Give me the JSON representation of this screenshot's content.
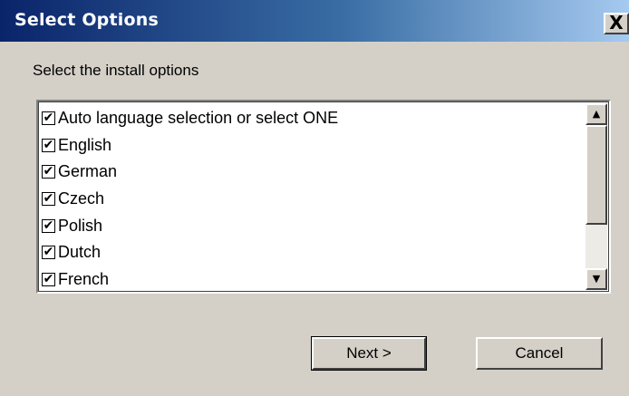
{
  "window": {
    "title": "Select Options",
    "close_glyph": "X"
  },
  "prompt": "Select the install options",
  "options": [
    {
      "label": "Auto language selection or select ONE",
      "checked": true
    },
    {
      "label": "English",
      "checked": true
    },
    {
      "label": "German",
      "checked": true
    },
    {
      "label": "Czech",
      "checked": true
    },
    {
      "label": "Polish",
      "checked": true
    },
    {
      "label": "Dutch",
      "checked": true
    },
    {
      "label": "French",
      "checked": true
    }
  ],
  "check_glyph": "✔",
  "scrollbar": {
    "up_icon": "arrow-up-icon",
    "down_icon": "arrow-down-icon",
    "up_glyph": "▲",
    "down_glyph": "▼"
  },
  "buttons": {
    "next": "Next >",
    "cancel": "Cancel"
  }
}
